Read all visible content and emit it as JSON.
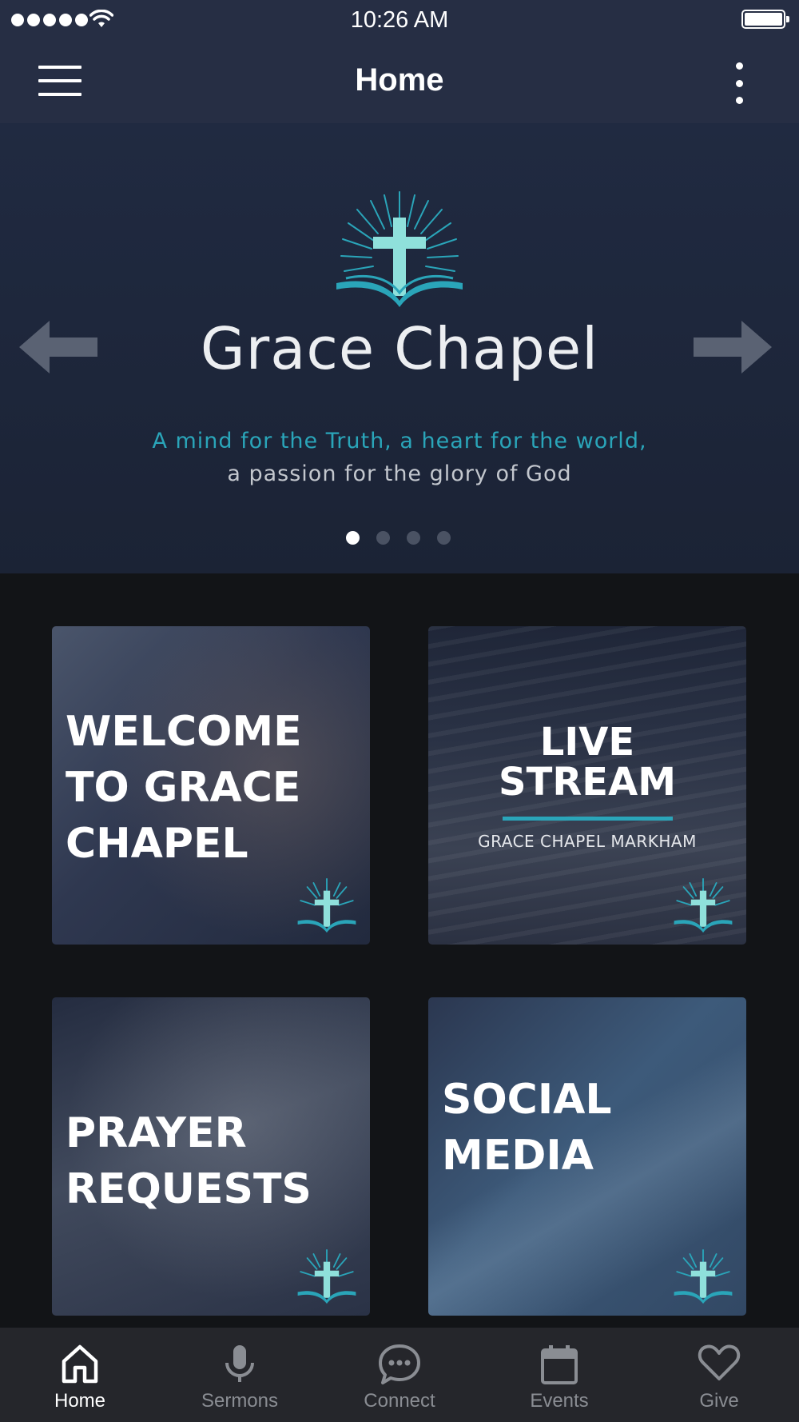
{
  "status_bar": {
    "time": "10:26 AM"
  },
  "nav": {
    "title": "Home"
  },
  "hero": {
    "title": "Grace Chapel",
    "tagline_line1": "A mind for the Truth, a heart for the world,",
    "tagline_line2": "a passion for the glory of God",
    "slide_count": 4,
    "active_slide": 1
  },
  "tiles": [
    {
      "lines": [
        "WELCOME",
        "TO GRACE",
        "CHAPEL"
      ]
    },
    {
      "lines": [
        "LIVE",
        "STREAM"
      ],
      "subtitle": "GRACE CHAPEL MARKHAM"
    },
    {
      "lines": [
        "PRAYER",
        "REQUESTS"
      ]
    },
    {
      "lines": [
        "SOCIAL",
        "MEDIA"
      ]
    }
  ],
  "tab_bar": {
    "items": [
      {
        "label": "Home",
        "icon": "home-icon",
        "active": true
      },
      {
        "label": "Sermons",
        "icon": "microphone-icon",
        "active": false
      },
      {
        "label": "Connect",
        "icon": "chat-bubble-icon",
        "active": false
      },
      {
        "label": "Events",
        "icon": "calendar-icon",
        "active": false
      },
      {
        "label": "Give",
        "icon": "heart-icon",
        "active": false
      }
    ]
  },
  "colors": {
    "accent": "#2aa5b9",
    "nav_background": "#262e44",
    "page_background": "#121417",
    "tab_bar_background": "#25262b"
  }
}
